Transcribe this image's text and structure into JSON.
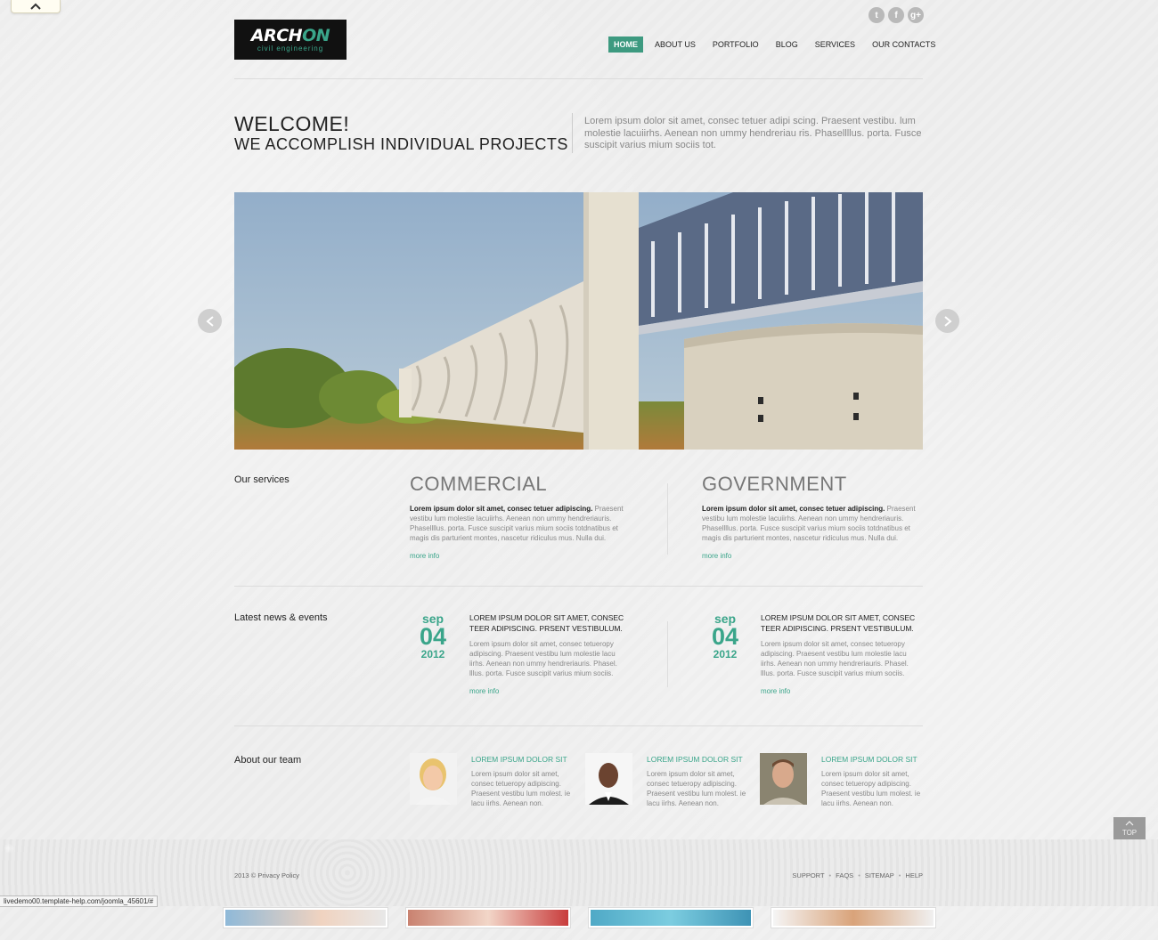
{
  "brand": {
    "logo_main": "ARCH",
    "logo_accent": "ON",
    "logo_tagline": "civil engineering",
    "accent_color": "#3aa58a",
    "logo_bg": "#111111"
  },
  "social": [
    {
      "icon": "twitter-icon",
      "glyph": "t"
    },
    {
      "icon": "facebook-icon",
      "glyph": "f"
    },
    {
      "icon": "google-plus-icon",
      "glyph": "g+"
    }
  ],
  "nav": {
    "items": [
      {
        "label": "HOME",
        "active": true
      },
      {
        "label": "ABOUT US",
        "active": false
      },
      {
        "label": "PORTFOLIO",
        "active": false
      },
      {
        "label": "BLOG",
        "active": false
      },
      {
        "label": "SERVICES",
        "active": false
      },
      {
        "label": "OUR CONTACTS",
        "active": false
      }
    ]
  },
  "welcome": {
    "line1": "WELCOME!",
    "line2": "WE ACCOMPLISH INDIVIDUAL PROJECTS",
    "text": "Lorem ipsum dolor sit amet, consec tetuer adipi scing. Praesent vestibu. lum molestie lacuiirhs. Aenean non ummy hendreriau ris. Phasellllus. porta. Fusce suscipit varius mium sociis tot."
  },
  "services": {
    "title": "Our services",
    "items": [
      {
        "heading": "COMMERCIAL",
        "lead": "Lorem ipsum dolor sit amet, consec tetuer adipiscing.",
        "body": " Praesent vestibu lum molestie lacuiirhs. Aenean non ummy hendreriauris. Phasellllus. porta. Fusce suscipit varius mium sociis totdnatibus et magis dis parturient montes, nascetur ridiculus mus. Nulla dui.",
        "more": "more info"
      },
      {
        "heading": "GOVERNMENT",
        "lead": "Lorem ipsum dolor sit amet, consec tetuer adipiscing.",
        "body": " Praesent vestibu lum molestie lacuiirhs. Aenean non ummy hendreriauris. Phasellllus. porta. Fusce suscipit varius mium sociis totdnatibus et magis dis parturient montes, nascetur ridiculus mus. Nulla dui.",
        "more": "more info"
      }
    ]
  },
  "news": {
    "title": "Latest news & events",
    "items": [
      {
        "month": "sep",
        "day": "04",
        "year": "2012",
        "headline": "LOREM IPSUM DOLOR SIT AMET, CONSEC TEER ADIPISCING. PRSENT VESTIBULUM.",
        "text": "Lorem ipsum dolor sit amet, consec tetueropy adipiscing. Praesent vestibu lum molestie lacu iirhs. Aenean non ummy hendreriauris. Phasel. lllus. porta. Fusce suscipit varius mium sociis.",
        "more": "more info"
      },
      {
        "month": "sep",
        "day": "04",
        "year": "2012",
        "headline": "LOREM IPSUM DOLOR SIT AMET, CONSEC TEER ADIPISCING. PRSENT VESTIBULUM.",
        "text": "Lorem ipsum dolor sit amet, consec tetueropy adipiscing. Praesent vestibu lum molestie lacu iirhs. Aenean non ummy hendreriauris. Phasel. lllus. porta. Fusce suscipit varius mium sociis.",
        "more": "more info"
      }
    ]
  },
  "team": {
    "title": "About our team",
    "members": [
      {
        "name": "LOREM IPSUM DOLOR SIT",
        "text": "Lorem ipsum dolor sit amet, consec tetueropy adipiscing. Praesent vestibu lum molest. ie lacu iirhs. Aenean non."
      },
      {
        "name": "LOREM IPSUM DOLOR SIT",
        "text": "Lorem ipsum dolor sit amet, consec tetueropy adipiscing. Praesent vestibu lum molest. ie lacu iirhs. Aenean non."
      },
      {
        "name": "LOREM IPSUM DOLOR SIT",
        "text": "Lorem ipsum dolor sit amet, consec tetueropy adipiscing. Praesent vestibu lum molest. ie lacu iirhs. Aenean non."
      }
    ]
  },
  "to_top": {
    "label": "TOP"
  },
  "footer": {
    "copyright": "2013 © Privacy Policy",
    "links": [
      "SUPPORT",
      "FAQS",
      "SITEMAP",
      "HELP"
    ]
  },
  "status_bar": {
    "url": "livedemo00.template-help.com/joomla_45601/#"
  }
}
